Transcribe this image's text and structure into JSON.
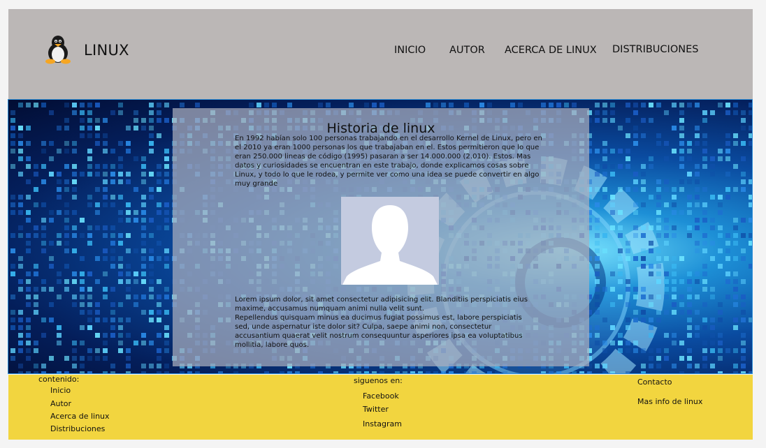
{
  "header": {
    "brand": "LINUX",
    "nav": [
      "INICIO",
      "AUTOR",
      "ACERCA DE LINUX",
      "DISTRIBUCIONES"
    ]
  },
  "main": {
    "title": "Historia de linux",
    "paragraph1": "En 1992 habían solo 100 personas trabajando en el desarrollo Kernel de Linux, pero en el 2010 ya eran 1000 personas los que trabajaban en el. Estos permitieron que lo que eran 250.000 lineas de código (1995) pasaran a ser 14.000.000 (2.010). Estos. Mas datos y curiosidades se encuentran en este trabajo, donde explicamos cosas sobre Linux, y todo lo que le rodea, y permite ver como una idea se puede convertir en algo muy grande",
    "paragraph2": "Lorem ipsum dolor, sit amet consectetur adipisicing elit. Blanditiis perspiciatis eius maxime, accusamus numquam animi nulla velit sunt.",
    "paragraph3": "Repellendus quisquam minus ea ducimus fugiat possimus est, labore perspiciatis sed, unde aspernatur iste dolor sit? Culpa, saepe animi non, consectetur accusantium quaerat velit nostrum consequuntur asperiores ipsa ea voluptatibus mollitia, labore quos."
  },
  "footer": {
    "contenido_label": "contenido:",
    "contenido_links": [
      "Inicio",
      "Autor",
      "Acerca de linux",
      "Distribuciones"
    ],
    "siguenos_label": "siguenos en:",
    "social_links": [
      "Facebook",
      "Twitter",
      "Instagram"
    ],
    "contacto": "Contacto",
    "mas_info": "Mas info de linux"
  },
  "colors": {
    "header_bg": "#bbb7b6",
    "footer_bg": "#f2d53f",
    "hero_accent": "#1d8fd6"
  }
}
